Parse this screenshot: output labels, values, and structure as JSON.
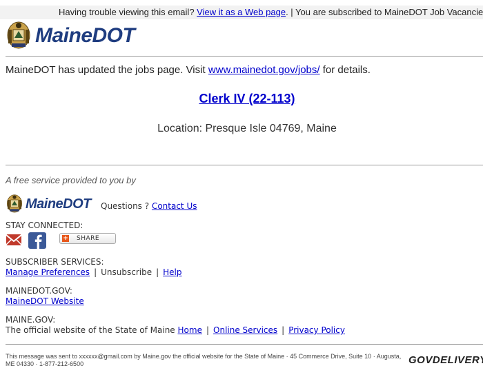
{
  "topbar": {
    "prefix": "Having trouble viewing this email?",
    "view_link": "View it as a Web page",
    "suffix": ". | You are subscribed to MaineDOT Job Vacancies"
  },
  "brand": {
    "name": "MaineDOT",
    "color": "#1f3d80"
  },
  "update": {
    "prefix": "MaineDOT has updated the jobs page. Visit",
    "link": "www.mainedot.gov/jobs/",
    "suffix": "for details."
  },
  "job": {
    "title": "Clerk IV (22-113)",
    "location": "Location: Presque Isle 04769, Maine"
  },
  "footer": {
    "free_service": "A free service provided to you by",
    "questions_label": "Questions ?",
    "contact_link": "Contact Us",
    "stay_connected": "STAY CONNECTED:",
    "share_label": "SHARE",
    "subscriber_services": "SUBSCRIBER SERVICES:",
    "manage_preferences": "Manage Preferences",
    "unsubscribe": "Unsubscribe",
    "help": "Help",
    "mainedot_gov": "MAINEDOT.GOV:",
    "mainedot_website": "MaineDOT Website",
    "maine_gov": "MAINE.GOV:",
    "official_text": "The official website of the State of Maine",
    "home": "Home",
    "online_services": "Online Services",
    "privacy_policy": "Privacy Policy",
    "sent_to": "This message was sent to xxxxxx@gmail.com by Maine.gov the official website for the State of Maine · 45 Commerce Drive, Suite 10 · Augusta, ME 04330 · 1-877-212-6500",
    "govdelivery": "GOVDELIVERY"
  },
  "separator": "|",
  "icons": [
    "state-seal-icon",
    "email-icon",
    "facebook-icon",
    "plus-icon"
  ],
  "colors": {
    "link": "#0000cc",
    "facebook": "#3b5998",
    "email": "#c0392b",
    "share_plus": "#e8581c"
  }
}
